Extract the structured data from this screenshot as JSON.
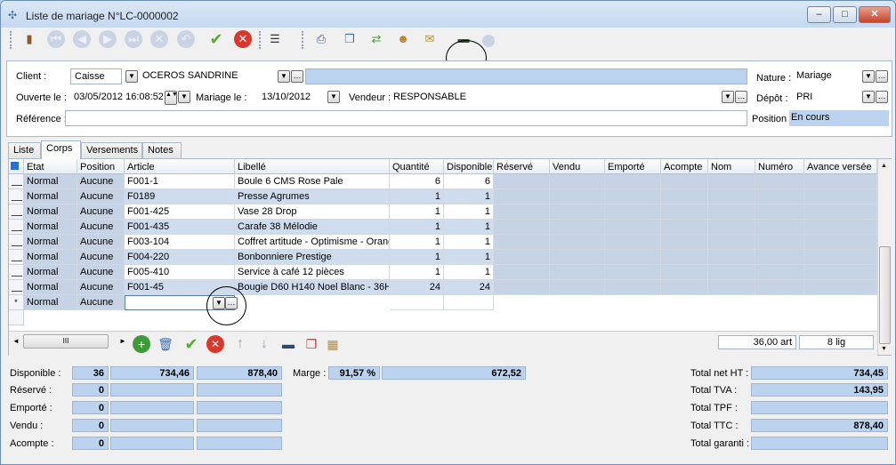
{
  "window": {
    "title": "Liste de mariage N°LC-0000002"
  },
  "header": {
    "client_label": "Client :",
    "client_type": "Caisse",
    "client_name": "OCEROS SANDRINE",
    "client_extra": "",
    "nature_label": "Nature :",
    "nature_value": "Mariage",
    "ouverte_label": "Ouverte le :",
    "ouverte_value": "03/05/2012 16:08:52",
    "mariage_label": "Mariage le :",
    "mariage_value": "13/10/2012",
    "vendeur_label": "Vendeur :",
    "vendeur_value": "RESPONSABLE",
    "depot_label": "Dépôt :",
    "depot_value": "PRI",
    "reference_label": "Référence :",
    "reference_value": "",
    "position_label": "Position :",
    "position_value": "En cours"
  },
  "tabs": [
    "Liste",
    "Corps",
    "Versements",
    "Notes"
  ],
  "grid": {
    "columns": [
      "Etat",
      "Position",
      "Article",
      "Libellé",
      "Quantité",
      "Disponible",
      "Réservé",
      "Vendu",
      "Emporté",
      "Acompte",
      "Nom",
      "Numéro",
      "Avance versée"
    ],
    "rows": [
      {
        "etat": "Normal",
        "position": "Aucune",
        "article": "F001-1",
        "libelle": "Boule 6 CMS Rose Pale",
        "quantite": "6",
        "disponible": "6"
      },
      {
        "etat": "Normal",
        "position": "Aucune",
        "article": "F0189",
        "libelle": "Presse Agrumes",
        "quantite": "1",
        "disponible": "1"
      },
      {
        "etat": "Normal",
        "position": "Aucune",
        "article": "F001-425",
        "libelle": "Vase 28 Drop",
        "quantite": "1",
        "disponible": "1"
      },
      {
        "etat": "Normal",
        "position": "Aucune",
        "article": "F001-435",
        "libelle": "Carafe 38 Mélodie",
        "quantite": "1",
        "disponible": "1"
      },
      {
        "etat": "Normal",
        "position": "Aucune",
        "article": "F003-104",
        "libelle": "Coffret artitude - Optimisme - Orange",
        "quantite": "1",
        "disponible": "1"
      },
      {
        "etat": "Normal",
        "position": "Aucune",
        "article": "F004-220",
        "libelle": "Bonbonniere Prestige",
        "quantite": "1",
        "disponible": "1"
      },
      {
        "etat": "Normal",
        "position": "Aucune",
        "article": "F005-410",
        "libelle": "Service à café 12 pièces",
        "quantite": "1",
        "disponible": "1"
      },
      {
        "etat": "Normal",
        "position": "Aucune",
        "article": "F001-45",
        "libelle": "Bougie D60 H140 Noel Blanc - 36H",
        "quantite": "24",
        "disponible": "24"
      }
    ],
    "new_row": {
      "marker": "*",
      "etat": "Normal",
      "position": "Aucune",
      "article": ""
    },
    "hscroll_label": "III",
    "total_articles": "36,00 art",
    "total_lines": "8 lig"
  },
  "summary": {
    "disponible_label": "Disponible :",
    "disponible_qty": "36",
    "disponible_v1": "734,46",
    "disponible_v2": "878,40",
    "marge_label": "Marge :",
    "marge_pct": "91,57 %",
    "marge_value": "672,52",
    "reserve_label": "Réservé :",
    "reserve_qty": "0",
    "emporte_label": "Emporté :",
    "emporte_qty": "0",
    "vendu_label": "Vendu :",
    "vendu_qty": "0",
    "acompte_label": "Acompte :",
    "acompte_qty": "0",
    "total_ht_label": "Total net HT :",
    "total_ht": "734,45",
    "total_tva_label": "Total TVA :",
    "total_tva": "143,95",
    "total_tpf_label": "Total TPF :",
    "total_tpf": "",
    "total_ttc_label": "Total TTC :",
    "total_ttc": "878,40",
    "total_garanti_label": "Total garanti :",
    "total_garanti": ""
  },
  "icons": [
    "door-exit-icon",
    "first-record-icon",
    "previous-record-icon",
    "next-record-icon",
    "last-record-icon",
    "delete-record-icon",
    "undo-icon",
    "validate-icon",
    "cancel-icon",
    "list-menu-icon",
    "print-icon",
    "document-icon",
    "transfer-icon",
    "people-icon",
    "gift-icon",
    "card-reader-icon",
    "disabled-icon"
  ],
  "colors": {
    "accent_blue": "#bcd3ef",
    "title_bar": "#c4d8ef",
    "highlight_circle": "#000000"
  }
}
